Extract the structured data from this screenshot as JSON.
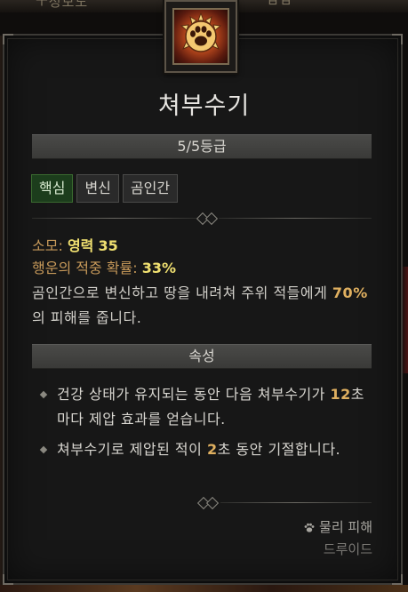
{
  "background": {
    "top_text_left": "ㅜ성보도",
    "top_text_right": "ㅂㅂ"
  },
  "skill": {
    "icon": "bear-paw-icon",
    "name": "쳐부수기",
    "rank": "5/5등급",
    "tags": [
      "핵심",
      "변신",
      "곰인간"
    ],
    "active_tag": "핵심"
  },
  "stats": {
    "cost_label": "소모:",
    "cost_resource": "영력",
    "cost_value": "35",
    "lucky_label": "행운의 적중 확률:",
    "lucky_value": "33%"
  },
  "description": {
    "part1": "곰인간으로 변신하고 땅을 내려쳐 주위 적들에게 ",
    "dmg_pct": "70%",
    "part2": "의 피해를 줍니다."
  },
  "properties": {
    "header": "속성",
    "items": [
      {
        "pre": "건강 상태가 유지되는 동안 다음 쳐부수기가 ",
        "num": "12",
        "post": "초마다 제압 효과를 얻습니다."
      },
      {
        "pre": "쳐부수기로 제압된 적이 ",
        "num": "2",
        "post": "초 동안 기절합니다."
      }
    ]
  },
  "footer": {
    "damage_icon": "claw-icon",
    "damage_type": "물리 피해",
    "class_name": "드루이드"
  },
  "colors": {
    "frame_bg": "#171717",
    "active_tag": "#1c3d1c",
    "value_yellow": "#f0e070",
    "number_orange": "#e0b060"
  }
}
